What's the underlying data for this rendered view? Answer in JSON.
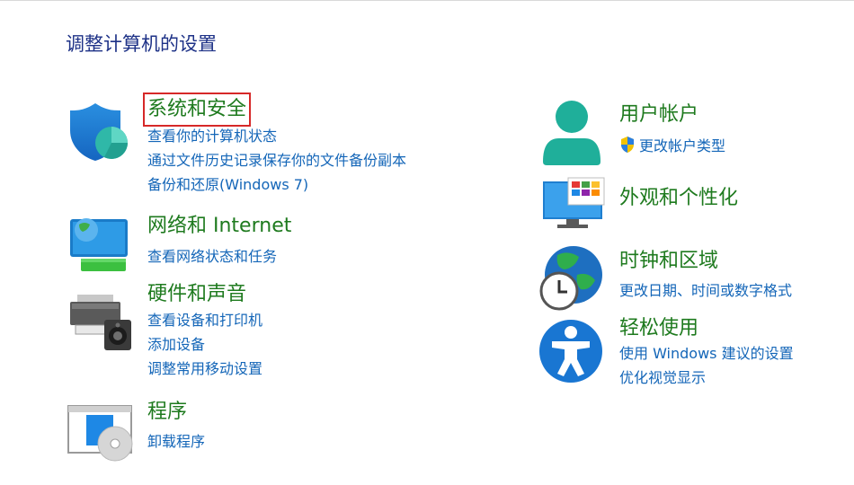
{
  "page": {
    "title": "调整计算机的设置"
  },
  "colors": {
    "title": "#1e3287",
    "category": "#1e7a1e",
    "link": "#1466b8",
    "highlight": "#d62828"
  },
  "categories": {
    "system_security": {
      "title": "系统和安全",
      "icon": "security-shield-icon",
      "links": [
        "查看你的计算机状态",
        "通过文件历史记录保存你的文件备份副本",
        "备份和还原(Windows 7)"
      ]
    },
    "network": {
      "title": "网络和 Internet",
      "icon": "network-globe-icon",
      "links": [
        "查看网络状态和任务"
      ]
    },
    "hardware": {
      "title": "硬件和声音",
      "icon": "printer-speaker-icon",
      "links": [
        "查看设备和打印机",
        "添加设备",
        "调整常用移动设置"
      ]
    },
    "programs": {
      "title": "程序",
      "icon": "programs-disc-icon",
      "links": [
        "卸载程序"
      ]
    },
    "user_accounts": {
      "title": "用户帐户",
      "icon": "user-icon",
      "links": [
        "更改帐户类型"
      ]
    },
    "appearance": {
      "title": "外观和个性化",
      "icon": "monitor-palette-icon",
      "links": []
    },
    "clock_region": {
      "title": "时钟和区域",
      "icon": "globe-clock-icon",
      "links": [
        "更改日期、时间或数字格式"
      ]
    },
    "ease_access": {
      "title": "轻松使用",
      "icon": "accessibility-icon",
      "links": [
        "使用 Windows 建议的设置",
        "优化视觉显示"
      ]
    }
  }
}
